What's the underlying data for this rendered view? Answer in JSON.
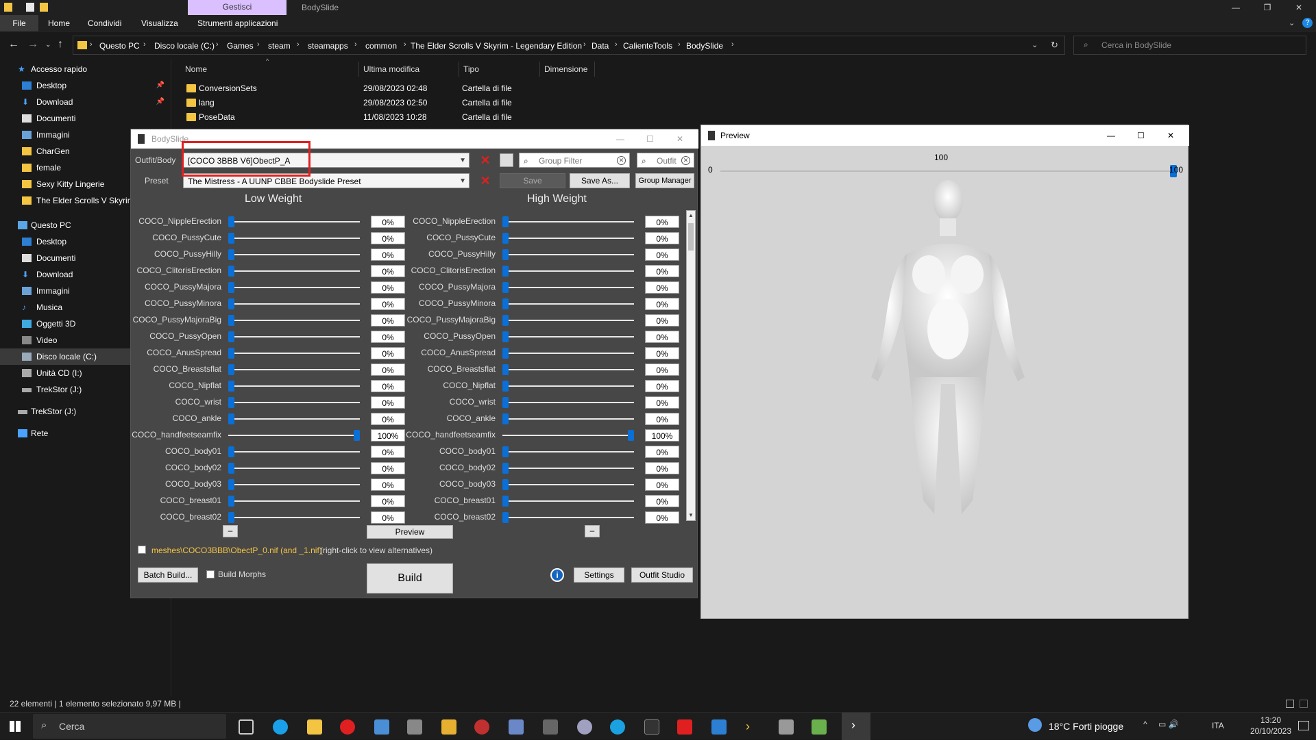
{
  "explorer": {
    "context_tab": "Gestisci",
    "window_title": "BodySlide",
    "ribbon_tabs": [
      "File",
      "Home",
      "Condividi",
      "Visualizza",
      "Strumenti applicazioni"
    ],
    "breadcrumb": [
      "Questo PC",
      "Disco locale (C:)",
      "Games",
      "steam",
      "steamapps",
      "common",
      "The Elder Scrolls V Skyrim - Legendary Edition",
      "Data",
      "CalienteTools",
      "BodySlide"
    ],
    "search_placeholder": "Cerca in BodySlide",
    "columns": [
      "Nome",
      "Ultima modifica",
      "Tipo",
      "Dimensione"
    ],
    "files": [
      {
        "name": "ConversionSets",
        "modified": "29/08/2023 02:48",
        "type": "Cartella di file"
      },
      {
        "name": "lang",
        "modified": "29/08/2023 02:50",
        "type": "Cartella di file"
      },
      {
        "name": "PoseData",
        "modified": "11/08/2023 10:28",
        "type": "Cartella di file"
      }
    ],
    "nav_quick": {
      "header": "Accesso rapido",
      "items": [
        "Desktop",
        "Download",
        "Documenti",
        "Immagini",
        "CharGen",
        "female",
        "Sexy Kitty Lingerie",
        "The Elder Scrolls V Skyrim"
      ]
    },
    "nav_pc": {
      "header": "Questo PC",
      "items": [
        "Desktop",
        "Documenti",
        "Download",
        "Immagini",
        "Musica",
        "Oggetti 3D",
        "Video",
        "Disco locale (C:)",
        "Unità CD (I:)",
        "TrekStor (J:)"
      ]
    },
    "nav_extra": [
      "TrekStor (J:)",
      "Rete"
    ],
    "status": "22 elementi  |  1 elemento selezionato  9,97 MB  |"
  },
  "bodyslide": {
    "title": "BodySlide",
    "outfit_label": "Outfit/Body",
    "outfit_value": "[COCO 3BBB V6]ObectP_A",
    "preset_label": "Preset",
    "preset_value": "The Mistress - A UUNP CBBE Bodyslide Preset",
    "group_filter_placeholder": "Group Filter",
    "outfit_filter_placeholder": "Outfit",
    "save_label": "Save",
    "save_as_label": "Save As...",
    "group_manager_label": "Group Manager",
    "low_weight": "Low Weight",
    "high_weight": "High Weight",
    "sliders": [
      {
        "name": "COCO_NippleErection",
        "low": "0%",
        "high": "0%",
        "low_value": 0,
        "high_value": 0
      },
      {
        "name": "COCO_PussyCute",
        "low": "0%",
        "high": "0%",
        "low_value": 0,
        "high_value": 0
      },
      {
        "name": "COCO_PussyHilly",
        "low": "0%",
        "high": "0%",
        "low_value": 0,
        "high_value": 0
      },
      {
        "name": "COCO_ClitorisErection",
        "low": "0%",
        "high": "0%",
        "low_value": 0,
        "high_value": 0
      },
      {
        "name": "COCO_PussyMajora",
        "low": "0%",
        "high": "0%",
        "low_value": 0,
        "high_value": 0
      },
      {
        "name": "COCO_PussyMinora",
        "low": "0%",
        "high": "0%",
        "low_value": 0,
        "high_value": 0
      },
      {
        "name": "COCO_PussyMajoraBig",
        "low": "0%",
        "high": "0%",
        "low_value": 0,
        "high_value": 0
      },
      {
        "name": "COCO_PussyOpen",
        "low": "0%",
        "high": "0%",
        "low_value": 0,
        "high_value": 0
      },
      {
        "name": "COCO_AnusSpread",
        "low": "0%",
        "high": "0%",
        "low_value": 0,
        "high_value": 0
      },
      {
        "name": "COCO_Breastsflat",
        "low": "0%",
        "high": "0%",
        "low_value": 0,
        "high_value": 0
      },
      {
        "name": "COCO_Nipflat",
        "low": "0%",
        "high": "0%",
        "low_value": 0,
        "high_value": 0
      },
      {
        "name": "COCO_wrist",
        "low": "0%",
        "high": "0%",
        "low_value": 0,
        "high_value": 0
      },
      {
        "name": "COCO_ankle",
        "low": "0%",
        "high": "0%",
        "low_value": 0,
        "high_value": 0
      },
      {
        "name": "COCO_handfeetseamfix",
        "low": "100%",
        "high": "100%",
        "low_value": 100,
        "high_value": 100
      },
      {
        "name": "COCO_body01",
        "low": "0%",
        "high": "0%",
        "low_value": 0,
        "high_value": 0
      },
      {
        "name": "COCO_body02",
        "low": "0%",
        "high": "0%",
        "low_value": 0,
        "high_value": 0
      },
      {
        "name": "COCO_body03",
        "low": "0%",
        "high": "0%",
        "low_value": 0,
        "high_value": 0
      },
      {
        "name": "COCO_breast01",
        "low": "0%",
        "high": "0%",
        "low_value": 0,
        "high_value": 0
      },
      {
        "name": "COCO_breast02",
        "low": "0%",
        "high": "0%",
        "low_value": 0,
        "high_value": 0
      }
    ],
    "preview_label": "Preview",
    "mesh_path": "meshes\\COCO3BBB\\ObectP_0.nif (and _1.nif)",
    "mesh_hint": "(right-click to view alternatives)",
    "batch_build_label": "Batch Build...",
    "build_morphs_label": "Build Morphs",
    "build_label": "Build",
    "settings_label": "Settings",
    "outfit_studio_label": "Outfit Studio"
  },
  "preview": {
    "title": "Preview",
    "slider_min": "0",
    "slider_max": "100",
    "slider_current": "100",
    "slider_value": 100
  },
  "taskbar": {
    "search_label": "Cerca",
    "weather": "18°C  Forti piogge",
    "lang": "ITA",
    "time": "13:20",
    "date": "20/10/2023"
  }
}
